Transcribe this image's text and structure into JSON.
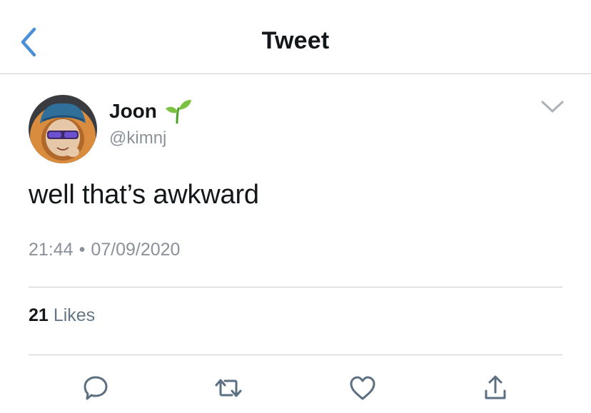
{
  "header": {
    "title": "Tweet",
    "back_icon": "chevron-left-icon",
    "accent_color": "#4a90d9"
  },
  "tweet": {
    "author": {
      "display_name": "Joon",
      "handle": "@kimnj",
      "name_emoji": "seedling-icon"
    },
    "text": "well that’s awkward",
    "time": "21:44",
    "separator": "•",
    "date": "07/09/2020",
    "likes_count": "21",
    "likes_label": "Likes"
  },
  "actions": [
    "reply-icon",
    "retweet-icon",
    "like-icon",
    "share-icon"
  ],
  "colors": {
    "text": "#14171a",
    "secondary": "#8a9199",
    "divider": "#c8ccd0",
    "action_icon": "#5b6f82"
  }
}
